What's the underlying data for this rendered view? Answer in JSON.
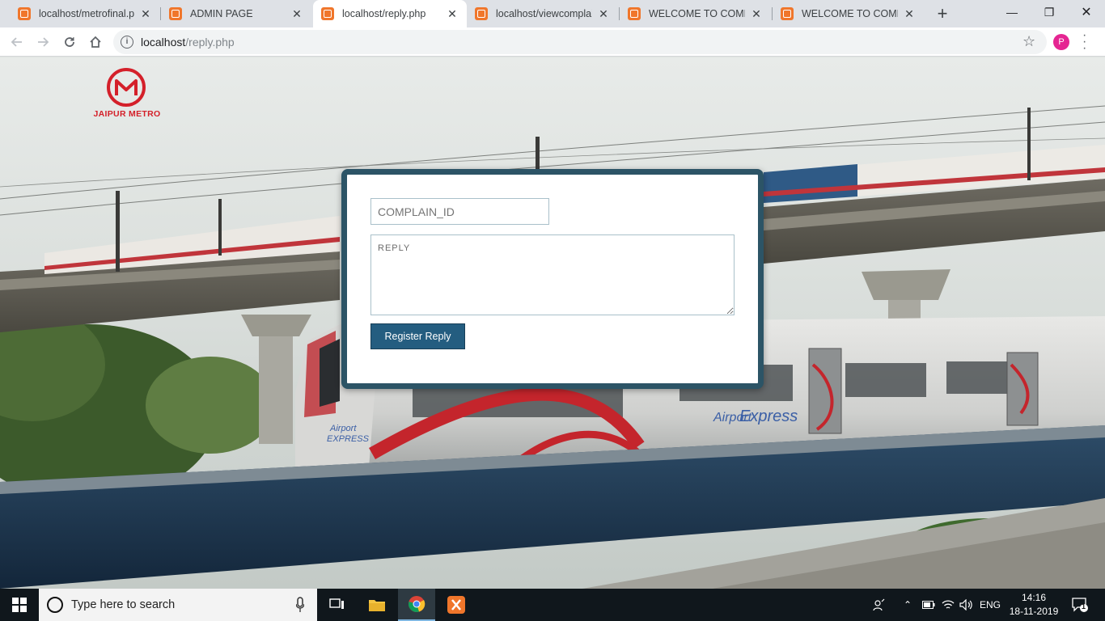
{
  "browser": {
    "tabs": [
      {
        "title": "localhost/metrofinal.php",
        "active": false
      },
      {
        "title": "ADMIN PAGE",
        "active": false
      },
      {
        "title": "localhost/reply.php",
        "active": true
      },
      {
        "title": "localhost/viewcomplaint",
        "active": false
      },
      {
        "title": "WELCOME TO COMPLAINT",
        "active": false
      },
      {
        "title": "WELCOME TO COMPLAINT",
        "active": false
      }
    ],
    "address_host": "localhost",
    "address_path": "/reply.php",
    "profile_initial": "P"
  },
  "page": {
    "logo_text": "JAIPUR METRO",
    "form": {
      "complain_id_placeholder": "COMPLAIN_ID",
      "reply_placeholder": "REPLY",
      "submit_label": "Register Reply"
    }
  },
  "taskbar": {
    "search_placeholder": "Type here to search",
    "language": "ENG",
    "time": "14:16",
    "date": "18-11-2019",
    "notification_count": "1"
  },
  "colors": {
    "card_border": "#2c5466",
    "submit_button": "#245d80",
    "logo_red": "#d4202a"
  }
}
